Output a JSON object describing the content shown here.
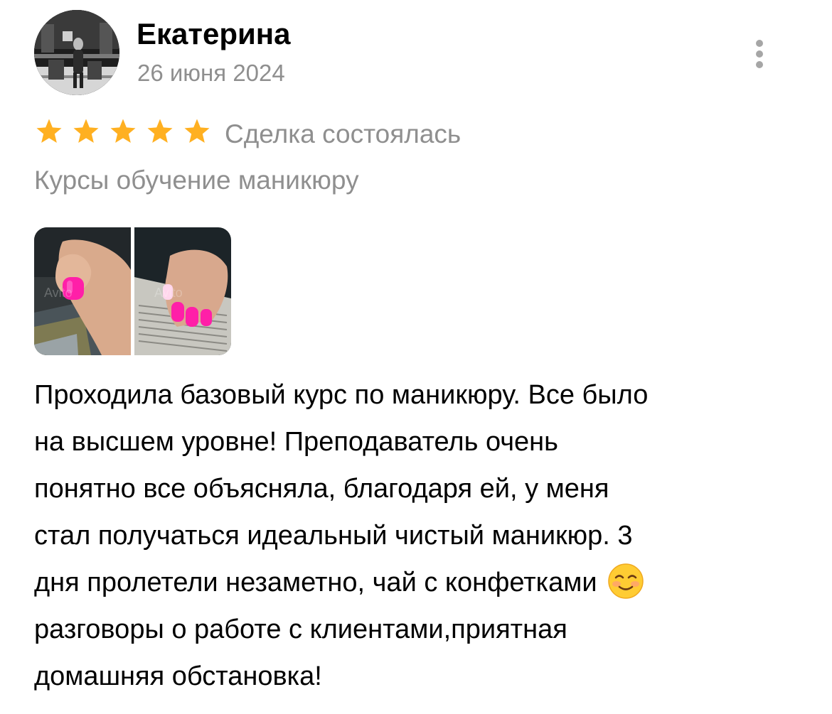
{
  "review": {
    "author": "Екатерина",
    "date": "26 июня 2024",
    "rating": 5,
    "deal_status": "Сделка состоялась",
    "ad_title": "Курсы обучение маникюру",
    "text_lines": [
      "Проходила базовый курс по маникюру. Все было",
      "на высшем уровне! Преподаватель очень",
      "понятно все объясняла, благодаря ей, у меня",
      "стал получаться идеальный чистый маникюр. 3",
      "дня пролетели незаметно, чай с конфетками",
      "разговоры о работе с клиентами,приятная",
      "домашняя обстановка!"
    ]
  },
  "icons": {
    "star": "star-icon",
    "more": "kebab-menu-icon",
    "emoji": "smiling-face-emoji"
  },
  "colors": {
    "star": "#FFB021",
    "secondary_text": "#8F8F8F",
    "menu_dots": "#A6A6A6",
    "nail_polish": "#FF1FA8"
  }
}
